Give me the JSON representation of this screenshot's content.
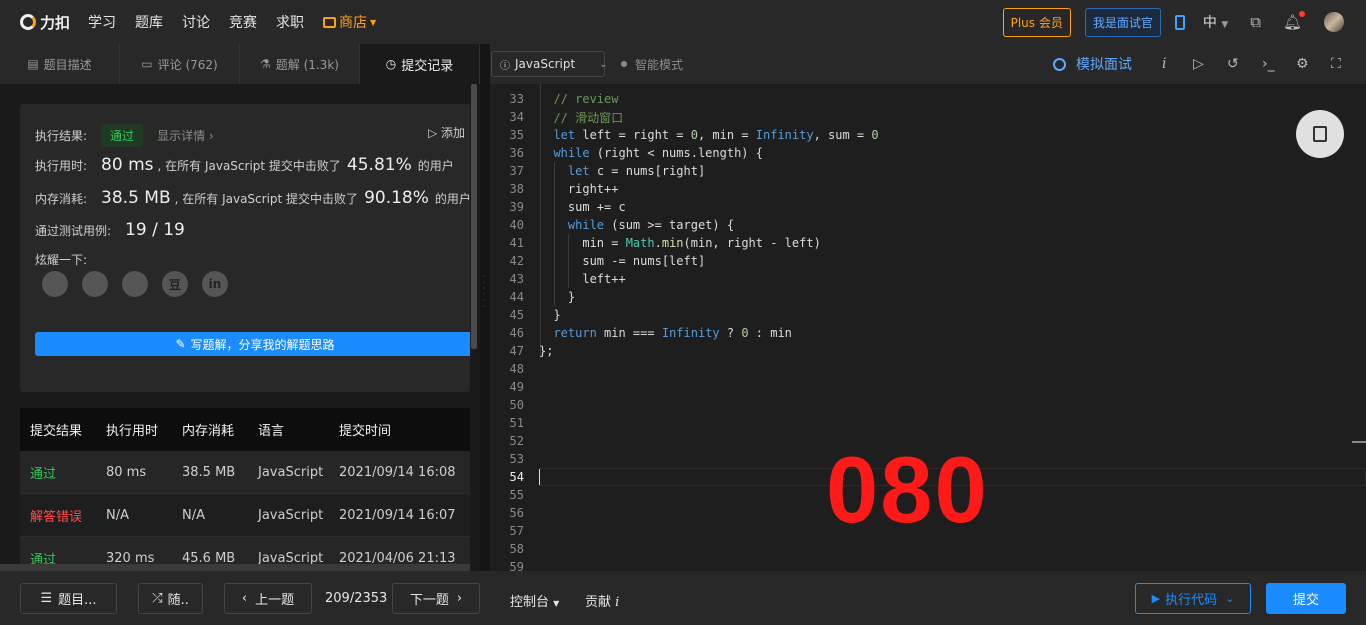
{
  "topbar": {
    "logo_text": "力扣",
    "nav": [
      "学习",
      "题库",
      "讨论",
      "竞赛",
      "求职"
    ],
    "store_label": "商店",
    "plus_label": "Plus 会员",
    "interviewer_label": "我是面试官",
    "lang_label": "中"
  },
  "tabs": [
    {
      "label": "题目描述"
    },
    {
      "label": "评论 (762)"
    },
    {
      "label": "题解 (1.3k)"
    },
    {
      "label": "提交记录"
    }
  ],
  "result": {
    "exec_result_label": "执行结果:",
    "status": "通过",
    "detail_link": "显示详情 ›",
    "add_note": "添加",
    "time_label": "执行用时:",
    "time_value": "80 ms",
    "time_desc": ", 在所有 JavaScript 提交中击败了",
    "time_percent": "45.81%",
    "users_suffix": "的用户",
    "mem_label": "内存消耗:",
    "mem_value": "38.5 MB",
    "mem_desc": ", 在所有 JavaScript 提交中击败了",
    "mem_percent": "90.18%",
    "cases_label": "通过测试用例:",
    "cases_value": "19 / 19",
    "share_label": "炫耀一下:",
    "share_icons": [
      "wechat-icon",
      "weibo-icon",
      "qq-icon",
      "douban-icon",
      "linkedin-icon"
    ],
    "share_glyphs": [
      "",
      "",
      "",
      "豆",
      "in"
    ],
    "write_label": "写题解，分享我的解题思路"
  },
  "submissions": {
    "headers": [
      "提交结果",
      "执行用时",
      "内存消耗",
      "语言",
      "提交时间"
    ],
    "rows": [
      {
        "status": "通过",
        "time": "80 ms",
        "memory": "38.5 MB",
        "lang": "JavaScript",
        "date": "2021/09/14 16:08"
      },
      {
        "status": "解答错误",
        "time": "N/A",
        "memory": "N/A",
        "lang": "JavaScript",
        "date": "2021/09/14 16:07"
      },
      {
        "status": "通过",
        "time": "320 ms",
        "memory": "45.6 MB",
        "lang": "JavaScript",
        "date": "2021/04/06 21:13"
      }
    ]
  },
  "editor_toolbar": {
    "language": "JavaScript",
    "smart_mode": "智能模式",
    "mock_interview": "模拟面试"
  },
  "code_lines": [
    {
      "n": "33",
      "text": "  // review"
    },
    {
      "n": "34",
      "text": "  // 滑动窗口"
    },
    {
      "n": "35",
      "text": "  let left = right = 0, min = Infinity, sum = 0"
    },
    {
      "n": "36",
      "text": "  while (right < nums.length) {"
    },
    {
      "n": "37",
      "text": "    let c = nums[right]"
    },
    {
      "n": "38",
      "text": "    right++"
    },
    {
      "n": "39",
      "text": "    sum += c"
    },
    {
      "n": "40",
      "text": "    while (sum >= target) {"
    },
    {
      "n": "41",
      "text": "      min = Math.min(min, right - left)"
    },
    {
      "n": "42",
      "text": "      sum -= nums[left]"
    },
    {
      "n": "43",
      "text": "      left++"
    },
    {
      "n": "44",
      "text": "    }"
    },
    {
      "n": "45",
      "text": "  }"
    },
    {
      "n": "46",
      "text": "  return min === Infinity ? 0 : min"
    },
    {
      "n": "47",
      "text": "};"
    },
    {
      "n": "48",
      "text": ""
    },
    {
      "n": "49",
      "text": ""
    },
    {
      "n": "50",
      "text": ""
    },
    {
      "n": "51",
      "text": ""
    },
    {
      "n": "52",
      "text": ""
    },
    {
      "n": "53",
      "text": ""
    },
    {
      "n": "54",
      "text": ""
    },
    {
      "n": "55",
      "text": ""
    },
    {
      "n": "56",
      "text": ""
    },
    {
      "n": "57",
      "text": ""
    },
    {
      "n": "58",
      "text": ""
    },
    {
      "n": "59",
      "text": ""
    }
  ],
  "overlay_number": "080",
  "bottombar": {
    "problems_label": "题目...",
    "random_label": "随..",
    "prev_label": "上一题",
    "counter": "209/2353",
    "next_label": "下一题",
    "console_label": "控制台",
    "contribute_label": "贡献",
    "run_label": "执行代码",
    "submit_label": "提交"
  },
  "colors": {
    "accent": "#1a8cff",
    "pass": "#35c75a",
    "fail": "#ff4d4f",
    "store": "#ffa116",
    "overlay": "#ff1a1a"
  }
}
